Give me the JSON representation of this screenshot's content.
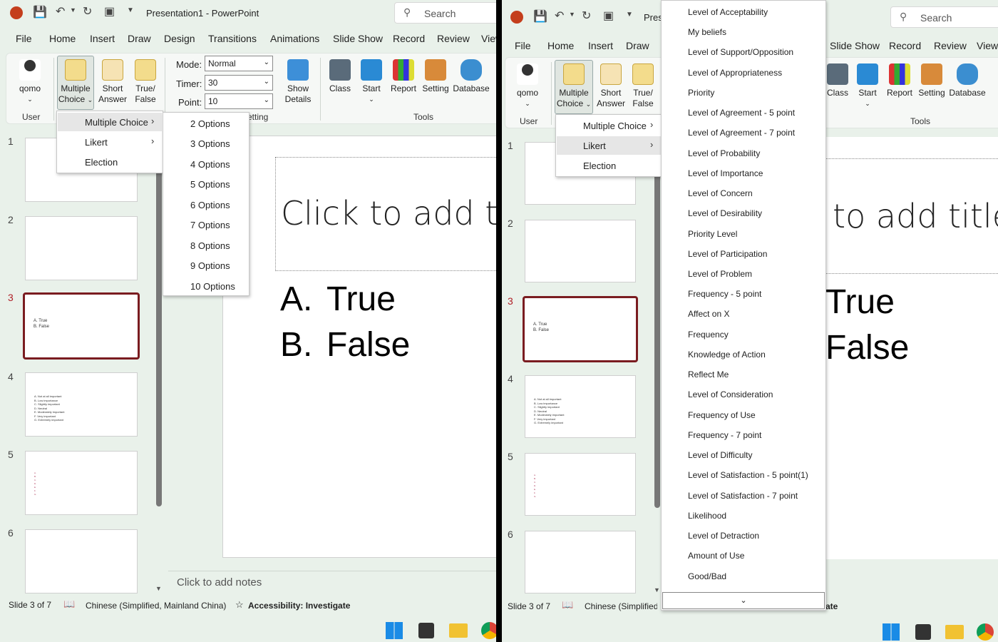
{
  "app": {
    "title": "Presentation1  -  PowerPoint",
    "title_short": "Pres",
    "search_placeholder": "Search"
  },
  "tabs": [
    "File",
    "Home",
    "Insert",
    "Draw",
    "Design",
    "Transitions",
    "Animations",
    "Slide Show",
    "Record",
    "Review",
    "View"
  ],
  "ribbon": {
    "user_label": "qomo",
    "user_group": "User",
    "multiple_choice": [
      "Multiple",
      "Choice"
    ],
    "short_answer": [
      "Short",
      "Answer"
    ],
    "true_false": [
      "True/",
      "False"
    ],
    "mode_label": "Mode:",
    "mode_value": "Normal",
    "timer_label": "Timer:",
    "timer_value": "30",
    "point_label": "Point:",
    "point_value": "10",
    "setting_group": "Setting",
    "show_details": [
      "Show",
      "Details"
    ],
    "class": "Class",
    "start": "Start",
    "report": "Report",
    "setting": "Setting",
    "database": "Database",
    "tools_group": "Tools"
  },
  "thumbnails": {
    "numbers": [
      "1",
      "2",
      "3",
      "4",
      "5",
      "6"
    ],
    "slide3_text": [
      "A. True",
      "B. False"
    ],
    "slide4_text": [
      "A. Not at all important",
      "B. Low importance",
      "C. Slightly important",
      "D. Neutral",
      "E. Moderately important",
      "F. Very important",
      "G. Extremely important"
    ],
    "slide5_text": [
      "A.",
      "B.",
      "C.",
      "D.",
      "E.",
      "F.",
      "G."
    ]
  },
  "slide": {
    "title_placeholder": "Click to add title",
    "option_a": "A.",
    "option_a_text": "True",
    "option_b": "B.",
    "option_b_text": "False",
    "notes_placeholder": "Click to add notes"
  },
  "status": {
    "slide_counter": "Slide 3 of 7",
    "language": "Chinese (Simplified, Mainland China)",
    "accessibility": "Accessibility: Investigate"
  },
  "mc_menu": [
    "Multiple Choice",
    "Likert",
    "Election"
  ],
  "options_submenu": [
    "2 Options",
    "3 Options",
    "4 Options",
    "5 Options",
    "6 Options",
    "7 Options",
    "8 Options",
    "9 Options",
    "10 Options"
  ],
  "likert_submenu": [
    "Level of Acceptability",
    "My beliefs",
    "Level of Support/Opposition",
    "Level of Appropriateness",
    "Priority",
    "Level of Agreement - 5 point",
    "Level of Agreement - 7 point",
    "Level of Probability",
    "Level of Importance",
    "Level of Concern",
    "Level of Desirability",
    "Priority Level",
    "Level of Participation",
    "Level of Problem",
    "Frequency - 5 point",
    "Affect on X",
    "Frequency",
    "Knowledge of Action",
    "Reflect Me",
    "Level of Consideration",
    "Frequency of Use",
    "Frequency - 7 point",
    "Level of Difficulty",
    "Level of Satisfaction - 5 point(1)",
    "Level of Satisfaction - 7 point",
    "Likelihood",
    "Level of Detraction",
    "Amount of Use",
    "Good/Bad"
  ],
  "colors": {
    "accent": "#7a1c20",
    "bg": "#e9f1ea",
    "ppt_red": "#c43e1c"
  }
}
